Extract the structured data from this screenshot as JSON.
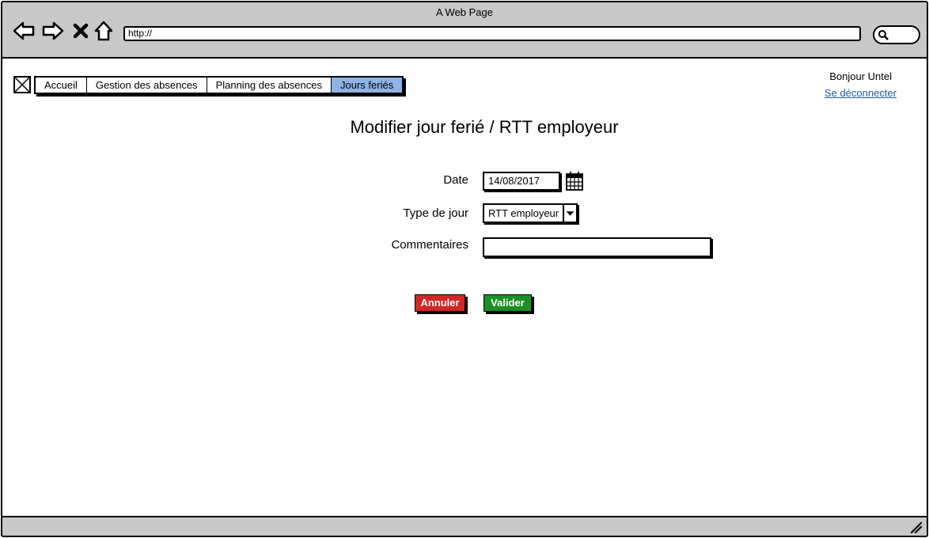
{
  "window": {
    "title": "A Web Page"
  },
  "browser": {
    "url": "http://",
    "icons": [
      "back-arrow-icon",
      "forward-arrow-icon",
      "close-icon",
      "home-icon",
      "search-icon"
    ]
  },
  "menu": {
    "items": [
      {
        "label": "Accueil",
        "active": false
      },
      {
        "label": "Gestion des absences",
        "active": false
      },
      {
        "label": "Planning des absences",
        "active": false
      },
      {
        "label": "Jours feriés",
        "active": true
      }
    ],
    "active_color": "#8fb3e6"
  },
  "user": {
    "greeting": "Bonjour Untel",
    "logout_label": "Se déconnecter"
  },
  "page": {
    "title": "Modifier jour ferié / RTT employeur"
  },
  "form": {
    "date_label": "Date",
    "date_value": "14/08/2017",
    "type_label": "Type de jour",
    "type_value": "RTT employeur",
    "comment_label": "Commentaires",
    "comment_value": ""
  },
  "buttons": {
    "cancel_label": "Annuler",
    "cancel_color": "#d32626",
    "ok_label": "Valider",
    "ok_color": "#1a8f24"
  }
}
